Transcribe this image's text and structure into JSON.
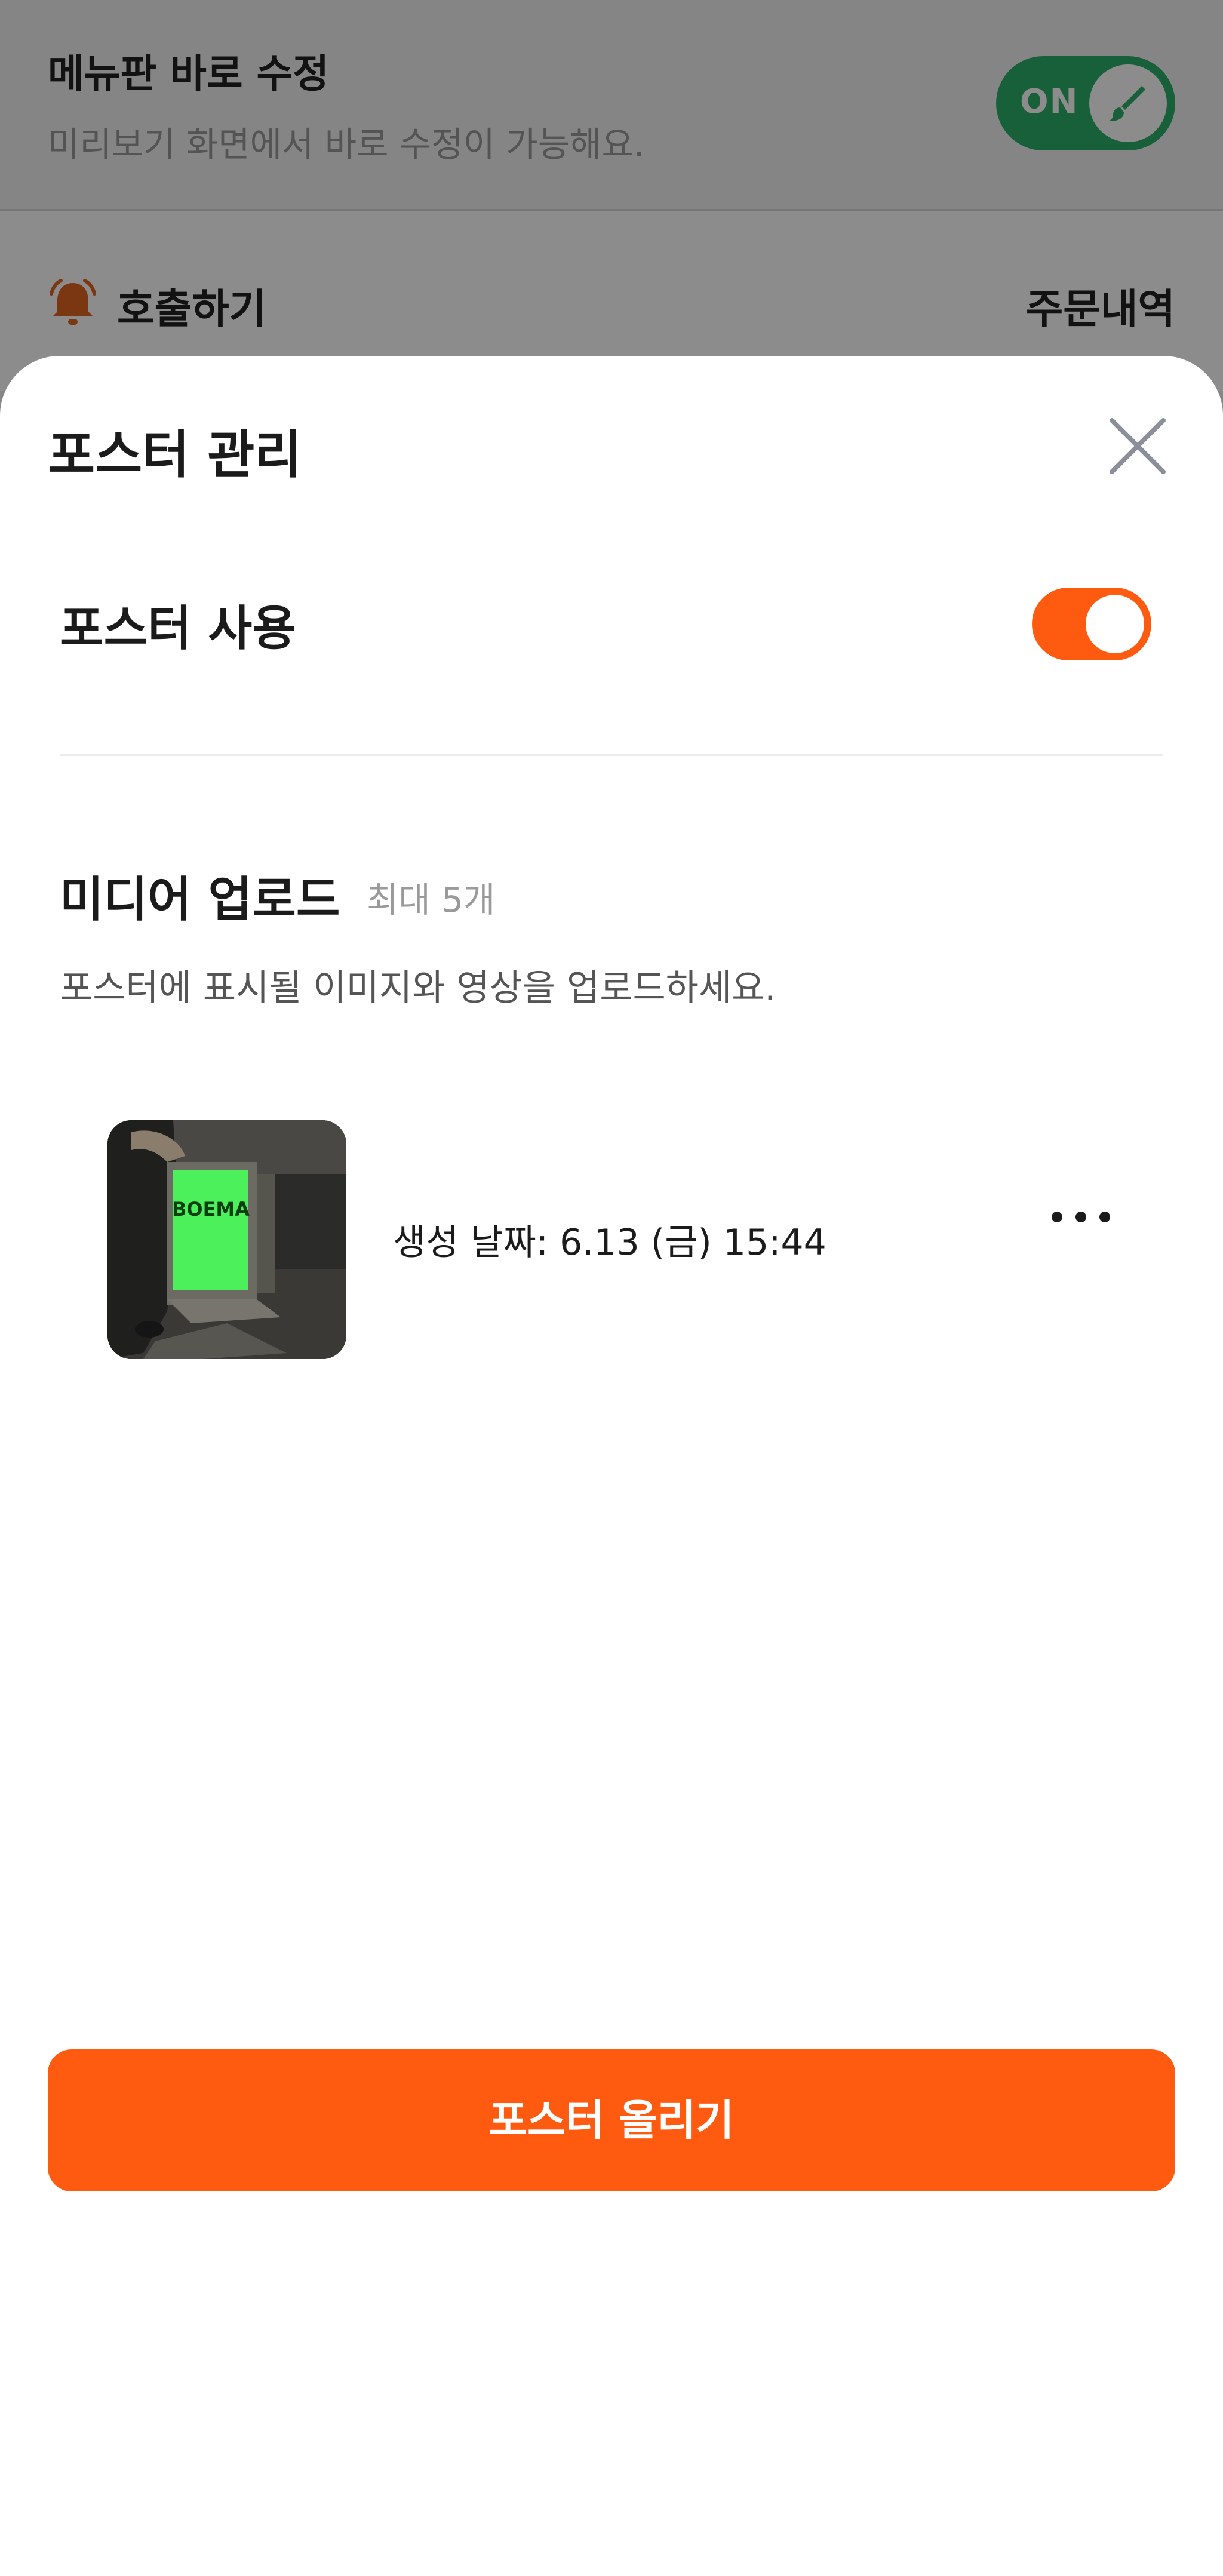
{
  "background": {
    "edit_title": "메뉴판 바로 수정",
    "edit_desc": "미리보기 화면에서 바로 수정이 가능해요.",
    "edit_toggle_label": "ON",
    "call_label": "호출하기",
    "orders_label": "주문내역",
    "icons": {
      "bell": "bell-icon",
      "brush": "brush-icon"
    }
  },
  "sheet": {
    "title": "포스터 관리",
    "close_icon": "close-icon",
    "poster_use_label": "포스터 사용",
    "poster_use_enabled": true,
    "media_title": "미디어 업로드",
    "media_max": "최대 5개",
    "media_desc": "포스터에 표시될 이미지와 영상을 업로드하세요.",
    "media_items": [
      {
        "created": "생성 날짜: 6.13 (금) 15:44",
        "thumbnail_text": "BOEMA",
        "more_icon": "more-icon"
      }
    ],
    "upload_button": "포스터 올리기"
  },
  "colors": {
    "accent": "#ff5b10",
    "toggle_on": "#2db06a",
    "bell": "#e1641f"
  }
}
